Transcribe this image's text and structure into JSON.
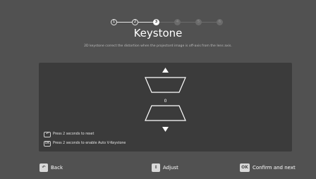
{
  "steps": [
    "1",
    "2",
    "3",
    "4",
    "5",
    "6"
  ],
  "title": "Keystone",
  "subtitle": "2D keystone correct the distortion when the projectord image is off-axis from the lens axis.",
  "panel": {
    "value": "0",
    "hints": [
      {
        "key": "↶",
        "text": "Press 2 seconds to reset"
      },
      {
        "key": "OK",
        "text": "Press 2 seconds to enable Auto V-Keystone"
      }
    ]
  },
  "footer": {
    "back_key": "↶",
    "back_label": "Back",
    "adjust_key": "⇕",
    "adjust_label": "Adjust",
    "confirm_key": "OK",
    "confirm_label": "Confirm and next"
  },
  "colors": {
    "background": "#515151",
    "panel": "#3b3b3b",
    "accent": "#ffffff"
  },
  "icons": {
    "back": "back-arrow-icon",
    "adjust": "up-down-icon",
    "ok": "ok-key-icon"
  }
}
